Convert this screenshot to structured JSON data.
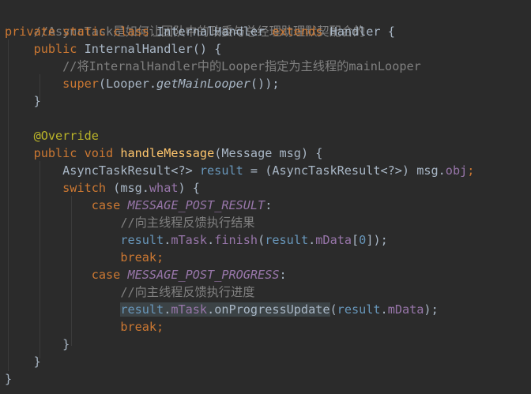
{
  "code": {
    "line_01_comment": "//AsyncTask是如何让团队中的政委与总经理助理默契配合的",
    "line_02": [
      "private",
      "static",
      "class",
      "InternalHandler",
      "extends",
      "Handler",
      "{"
    ],
    "line_03": [
      "public",
      "InternalHandler",
      "() {"
    ],
    "line_04_comment": "//将InternalHandler中的Looper指定为主线程的mainLooper",
    "line_05": [
      "super",
      "(Looper.",
      "getMainLooper",
      "());"
    ],
    "line_06": "}",
    "line_08_annotation": "@Override",
    "line_09": [
      "public",
      "void",
      "handleMessage",
      "(Message msg) {"
    ],
    "line_10": [
      "AsyncTaskResult<?> ",
      "result",
      " = (AsyncTaskResult<?>) msg.",
      "obj",
      ";"
    ],
    "line_11": [
      "switch",
      " (msg.",
      "what",
      ") {"
    ],
    "line_12": [
      "case",
      "MESSAGE_POST_RESULT",
      ":"
    ],
    "line_13_comment": "//向主线程反馈执行结果",
    "line_14": [
      "result",
      ".",
      "mTask",
      ".",
      "finish",
      "(",
      "result",
      ".",
      "mData",
      "[",
      "0",
      "]);"
    ],
    "line_15": [
      "break",
      ";"
    ],
    "line_16": [
      "case",
      "MESSAGE_POST_PROGRESS",
      ":"
    ],
    "line_17_comment": "//向主线程反馈执行进度",
    "line_18": [
      "result",
      ".",
      "mTask",
      ".onProgressUpdate",
      "(",
      "result",
      ".",
      "mData",
      ");"
    ],
    "line_19": [
      "break",
      ";"
    ],
    "line_20": "}",
    "line_21": "}",
    "line_22": "}"
  },
  "colors": {
    "background": "#2b2b2b",
    "default_text": "#a9b7c6",
    "keyword": "#cc7832",
    "comment": "#808080",
    "annotation": "#bbb529",
    "field": "#9876aa",
    "number": "#6897bb",
    "current_line": "#3c4346"
  }
}
